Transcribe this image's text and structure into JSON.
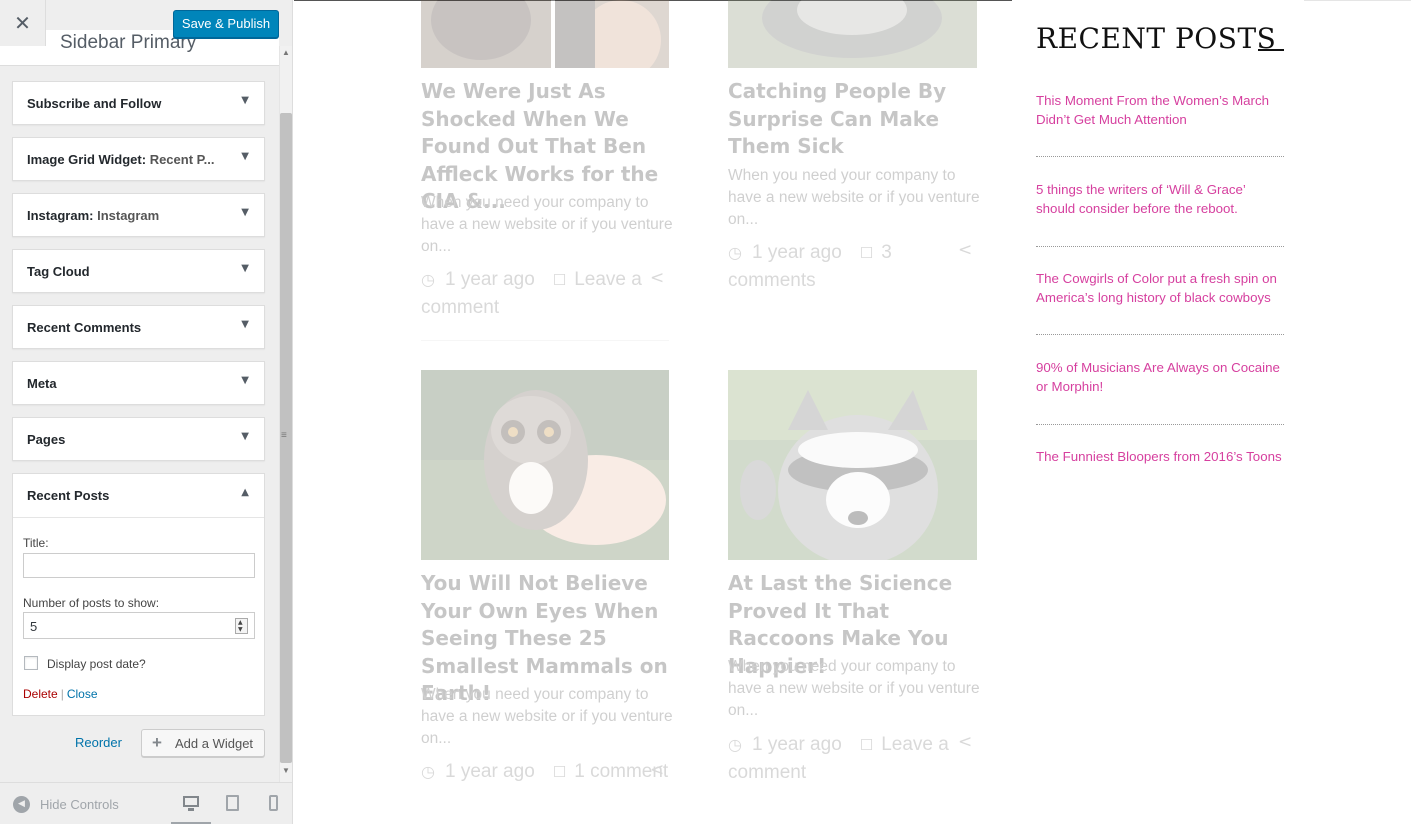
{
  "customizer": {
    "close_icon": "✕",
    "save_label": "Save & Publish",
    "section_title": "Sidebar Primary",
    "widgets": [
      {
        "title": "Subscribe and Follow",
        "subtitle": ""
      },
      {
        "title": "Image Grid Widget:",
        "subtitle": "Recent P..."
      },
      {
        "title": "Instagram:",
        "subtitle": "Instagram"
      },
      {
        "title": "Tag Cloud",
        "subtitle": ""
      },
      {
        "title": "Recent Comments",
        "subtitle": ""
      },
      {
        "title": "Meta",
        "subtitle": ""
      },
      {
        "title": "Pages",
        "subtitle": ""
      }
    ],
    "expanded_widget": {
      "title": "Recent Posts",
      "title_label": "Title:",
      "title_value": "",
      "number_label": "Number of posts to show:",
      "number_value": "5",
      "display_date_label": "Display post date?",
      "display_date_checked": false,
      "delete_label": "Delete",
      "separator": "|",
      "close_label": "Close"
    },
    "reorder_label": "Reorder",
    "add_widget_label": "Add a Widget",
    "add_widget_icon": "+",
    "footer": {
      "hide_controls_label": "Hide Controls",
      "active_device": "desktop"
    }
  },
  "preview": {
    "posts": [
      {
        "title": "We Were Just As Shocked When We Found Out That Ben Affleck Works for the CIA &...",
        "excerpt": "When you need your company to have a new website or if you venture on...",
        "time": "1 year ago",
        "comments": "Leave a comment",
        "image": "portrait-photo"
      },
      {
        "title": "Catching People By Surprise Can Make Them Sick",
        "excerpt": "When you need your company to have a new website or if you venture on...",
        "time": "1 year ago",
        "comments": "3 comments",
        "image": "animal-fur-photo"
      },
      {
        "title": "You Will Not Believe Your Own Eyes When Seeing These 25 Smallest Mammals on Earth!",
        "excerpt": "When you need your company to have a new website or if you venture on...",
        "time": "1 year ago",
        "comments": "1 comment",
        "image": "slow-loris-photo"
      },
      {
        "title": "At Last the Sicience Proved It That Raccoons Make You Happier!",
        "excerpt": "When you need your company to have a new website or if you venture on...",
        "time": "1 year ago",
        "comments": "Leave a comment",
        "image": "raccoon-photo"
      }
    ],
    "sidebar": {
      "heading": "RECENT POSTS",
      "links": [
        "This Moment From the Women’s March Didn’t Get Much Attention",
        "5 things the writers of ‘Will & Grace’ should consider before the reboot.",
        "The Cowgirls of Color put a fresh spin on America’s long history of black cowboys",
        "90% of Musicians Are Always on Cocaine or Morphin!",
        "The Funniest Bloopers from 2016’s Toons"
      ]
    }
  },
  "colors": {
    "primary_button": "#0085ba",
    "link": "#0073aa",
    "delete": "#aa0000",
    "accent_pink": "#d6409f"
  }
}
